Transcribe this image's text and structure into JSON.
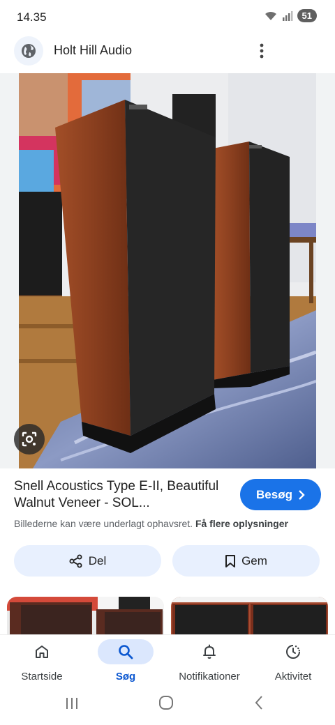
{
  "status_bar": {
    "time": "14.35",
    "battery": "51"
  },
  "header": {
    "site_name": "Holt Hill Audio",
    "globe_icon": "globe-icon",
    "more_icon": "more-vert-icon"
  },
  "result": {
    "title": "Snell Acoustics Type E-II, Beautiful Walnut Veneer - SOL...",
    "visit_label": "Besøg",
    "disclaimer": "Billederne kan være underlagt ophavsret.",
    "more_info": "Få flere oplysninger"
  },
  "actions": {
    "share_label": "Del",
    "save_label": "Gem"
  },
  "bottom_nav": {
    "items": [
      {
        "label": "Startside",
        "icon": "home-icon"
      },
      {
        "label": "Søg",
        "icon": "search-icon",
        "active": true
      },
      {
        "label": "Notifikationer",
        "icon": "bell-icon"
      },
      {
        "label": "Aktivitet",
        "icon": "activity-icon"
      }
    ]
  },
  "colors": {
    "accent": "#1a73e8",
    "pill_bg": "#e8f0fe",
    "active_nav": "#0b57d0",
    "walnut": "#8a3f1f"
  }
}
